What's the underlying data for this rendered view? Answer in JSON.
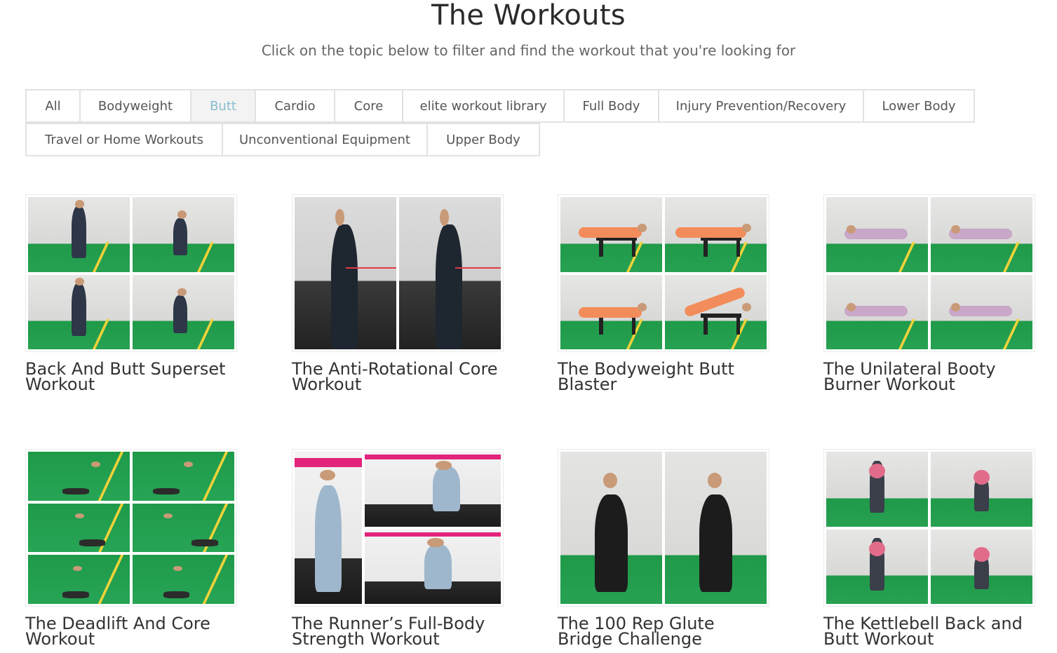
{
  "header": {
    "title": "The Workouts",
    "subtitle": "Click on the topic below to filter and find the workout that you're looking for"
  },
  "filters": {
    "active": "Butt",
    "row1": [
      "All",
      "Bodyweight",
      "Butt",
      "Cardio",
      "Core",
      "elite workout library",
      "Full Body",
      "Injury Prevention/Recovery",
      "Lower Body"
    ],
    "row2": [
      "Travel or Home Workouts",
      "Unconventional Equipment",
      "Upper Body"
    ]
  },
  "workouts": [
    {
      "title": "Back And Butt Superset Workout"
    },
    {
      "title": "The Anti-Rotational Core Workout"
    },
    {
      "title": "The Bodyweight Butt Blaster"
    },
    {
      "title": "The Unilateral Booty Burner Workout"
    },
    {
      "title": "The Deadlift And Core Workout"
    },
    {
      "title": "The Runner’s Full-Body Strength Workout"
    },
    {
      "title": "The 100 Rep Glute Bridge Challenge"
    },
    {
      "title": "The Kettlebell Back and Butt Workout"
    }
  ],
  "colors": {
    "active_filter_text": "#86bccf",
    "active_filter_bg": "#f3f3f3",
    "filter_border": "#e2e2e2",
    "turf_green": "#27a152"
  }
}
